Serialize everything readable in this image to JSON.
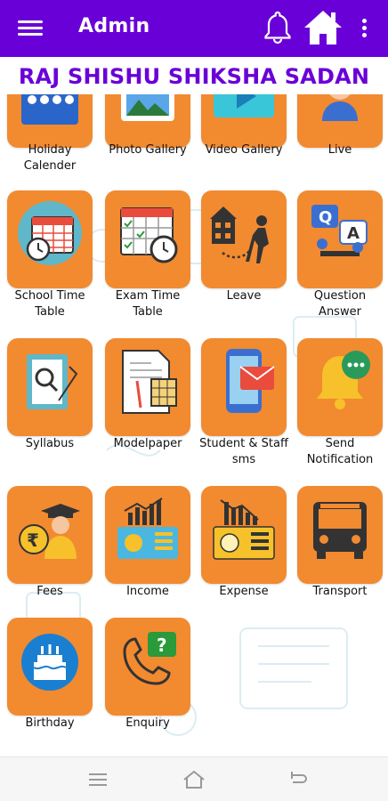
{
  "app_bar": {
    "title": "Admin",
    "color": "#6a00d8",
    "icons": [
      "menu-icon",
      "bell-icon",
      "home-icon",
      "more-vert-icon"
    ]
  },
  "school_name": "RAJ SHISHU SHIKSHA SADAN",
  "tile_color": "#f28a30",
  "tiles": [
    {
      "label": "Holiday Calender",
      "icon": "holiday-calendar-icon"
    },
    {
      "label": "Photo Gallery",
      "icon": "photo-gallery-icon"
    },
    {
      "label": "Video Gallery",
      "icon": "video-gallery-icon"
    },
    {
      "label": "Live",
      "icon": "live-icon"
    },
    {
      "label": "School Time Table",
      "icon": "school-time-table-icon"
    },
    {
      "label": "Exam Time Table",
      "icon": "exam-time-table-icon"
    },
    {
      "label": "Leave",
      "icon": "leave-icon"
    },
    {
      "label": "Question Answer",
      "icon": "question-answer-icon"
    },
    {
      "label": "Syllabus",
      "icon": "syllabus-icon"
    },
    {
      "label": "Modelpaper",
      "icon": "modelpaper-icon"
    },
    {
      "label": "Student & Staff sms",
      "icon": "sms-icon"
    },
    {
      "label": "Send Notification",
      "icon": "notification-bell-icon"
    },
    {
      "label": "Fees",
      "icon": "fees-icon"
    },
    {
      "label": "Income",
      "icon": "income-icon"
    },
    {
      "label": "Expense",
      "icon": "expense-icon"
    },
    {
      "label": "Transport",
      "icon": "bus-icon"
    },
    {
      "label": "Birthday",
      "icon": "birthday-cake-icon"
    },
    {
      "label": "Enquiry",
      "icon": "enquiry-phone-icon"
    }
  ],
  "nav_bar": {
    "icons": [
      "recent-apps-icon",
      "home-nav-icon",
      "back-nav-icon"
    ]
  }
}
